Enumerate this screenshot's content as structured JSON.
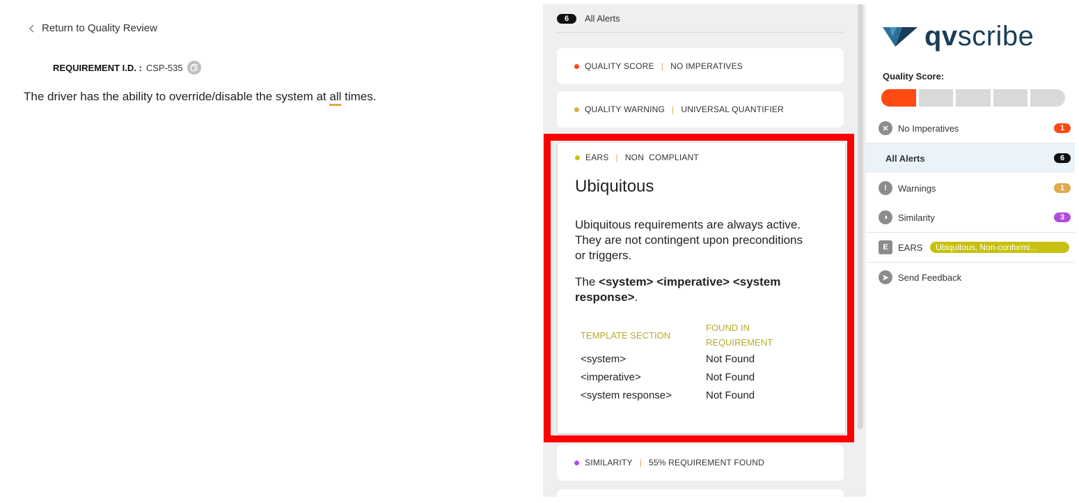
{
  "left": {
    "back_label": "Return to Quality Review",
    "req_id_label": "REQUIREMENT I.D. :",
    "req_id_value": "CSP-535",
    "req_text_before": "The driver has the ability to override/disable the system at ",
    "req_text_highlight": "all",
    "req_text_after": " times."
  },
  "alerts_header": {
    "count": "6",
    "label": "All Alerts"
  },
  "cards": [
    {
      "category": "QUALITY SCORE",
      "detail": "NO IMPERATIVES",
      "dot_color": "#ff4a12"
    },
    {
      "category": "QUALITY WARNING",
      "detail": "UNIVERSAL QUANTIFIER",
      "dot_color": "#e0a94a"
    },
    {
      "category": "SIMILARITY",
      "detail": "55% REQUIREMENT FOUND",
      "dot_color": "#b24be0"
    }
  ],
  "ears_card": {
    "category": "EARS",
    "detail": "NON  COMPLIANT",
    "dot_color": "#c7c010",
    "title": "Ubiquitous",
    "description": "Ubiquitous requirements are always active. They are not contingent upon preconditions or triggers.",
    "template_prefix": "The ",
    "template_bold": "<system> <imperative> <system response>",
    "template_suffix": ".",
    "table": {
      "header_section": "TEMPLATE SECTION",
      "header_found_1": "FOUND IN",
      "header_found_2": "REQUIREMENT",
      "rows": [
        {
          "section": "<system>",
          "found": "Not Found"
        },
        {
          "section": "<imperative>",
          "found": "Not Found"
        },
        {
          "section": "<system response>",
          "found": "Not Found"
        }
      ]
    }
  },
  "sidebar": {
    "logo_bold": "qv",
    "logo_rest": "scribe",
    "quality_score_label": "Quality Score:",
    "quality_score_level": 1,
    "quality_score_max": 5,
    "items": [
      {
        "label": "No Imperatives",
        "badge": "1",
        "badge_color": "#ff4a12",
        "icon": "x-circle-icon"
      },
      {
        "label": "All Alerts",
        "badge": "6",
        "badge_color": "#111111",
        "icon": ""
      },
      {
        "label": "Warnings",
        "badge": "1",
        "badge_color": "#e0a94a",
        "icon": "warning-icon"
      },
      {
        "label": "Similarity",
        "badge": "3",
        "badge_color": "#b24be0",
        "icon": "similarity-icon"
      },
      {
        "label": "EARS",
        "badge": "Ubiquitous, Non-conformi...",
        "badge_color": "#c7c010",
        "icon": "ears-icon"
      },
      {
        "label": "Send Feedback",
        "badge": "",
        "badge_color": "",
        "icon": "send-icon"
      }
    ]
  }
}
